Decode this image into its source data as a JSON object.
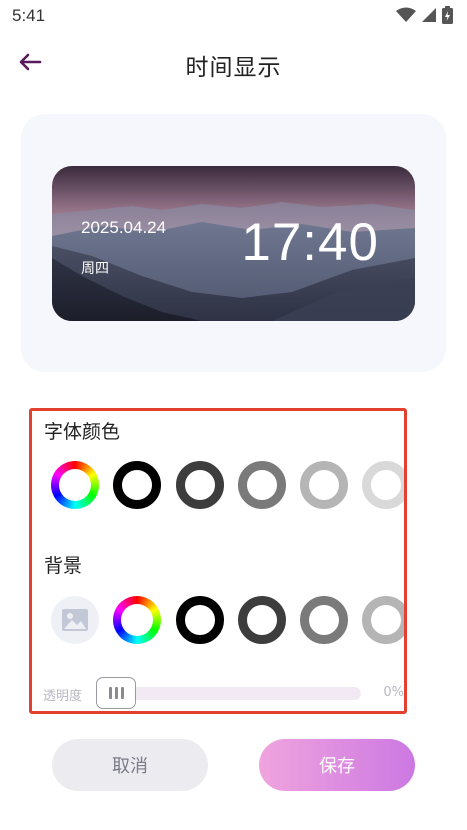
{
  "status_bar": {
    "time": "5:41"
  },
  "header": {
    "title": "时间显示"
  },
  "preview": {
    "date": "2025.04.24",
    "weekday": "周四",
    "clock": "17:40"
  },
  "font_color": {
    "label": "字体颜色",
    "swatches": [
      "#000000",
      "#3d3d3d",
      "#7a7a7a",
      "#b5b5b5",
      "#d9d9d9",
      "#f7f0c8"
    ]
  },
  "background": {
    "label": "背景",
    "swatches": [
      "#000000",
      "#3d3d3d",
      "#7a7a7a",
      "#b5b5b5",
      "#d9d9d9"
    ],
    "opacity_label": "透明度",
    "opacity_value": "0%",
    "opacity": 0
  },
  "actions": {
    "cancel": "取消",
    "save": "保存"
  },
  "colors": {
    "accent": "#cc78e2",
    "highlight_border": "#e3412f"
  }
}
